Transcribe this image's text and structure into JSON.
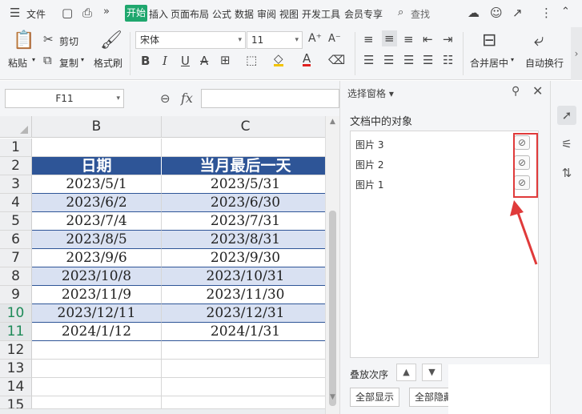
{
  "menu": {
    "file": "文件",
    "active_tab": "开始",
    "tabs": [
      "插入",
      "页面布局",
      "公式",
      "数据",
      "审阅",
      "视图",
      "开发工具",
      "会员专享"
    ],
    "search": "查找"
  },
  "ribbon": {
    "paste": "粘贴",
    "cut": "剪切",
    "copy": "复制",
    "format_painter": "格式刷",
    "font_name": "宋体",
    "font_size": "11",
    "merge_center": "合并居中",
    "wrap_text": "自动换行"
  },
  "formula_bar": {
    "cell_ref": "F11",
    "fx": "fx",
    "value": ""
  },
  "grid": {
    "columns": [
      "B",
      "C"
    ],
    "row_numbers": [
      "1",
      "2",
      "3",
      "4",
      "5",
      "6",
      "7",
      "8",
      "9",
      "10",
      "11",
      "12",
      "13",
      "14",
      "15"
    ],
    "header_row": [
      "日期",
      "当月最后一天"
    ],
    "rows": [
      [
        "2023/5/1",
        "2023/5/31"
      ],
      [
        "2023/6/2",
        "2023/6/30"
      ],
      [
        "2023/7/4",
        "2023/7/31"
      ],
      [
        "2023/8/5",
        "2023/8/31"
      ],
      [
        "2023/9/6",
        "2023/9/30"
      ],
      [
        "2023/10/8",
        "2023/10/31"
      ],
      [
        "2023/11/9",
        "2023/11/30"
      ],
      [
        "2023/12/11",
        "2023/12/31"
      ],
      [
        "2024/1/12",
        "2024/1/31"
      ]
    ]
  },
  "selection_pane": {
    "title": "选择窗格",
    "objects_label": "文档中的对象",
    "objects": [
      "图片 3",
      "图片 2",
      "图片 1"
    ],
    "order_label": "叠放次序",
    "show_all": "全部显示",
    "hide_all": "全部隐藏"
  },
  "colors": {
    "accent_green": "#1fa76e",
    "table_header": "#2e5597",
    "table_band": "#d9e1f2",
    "highlight_red": "#e03a3a"
  }
}
